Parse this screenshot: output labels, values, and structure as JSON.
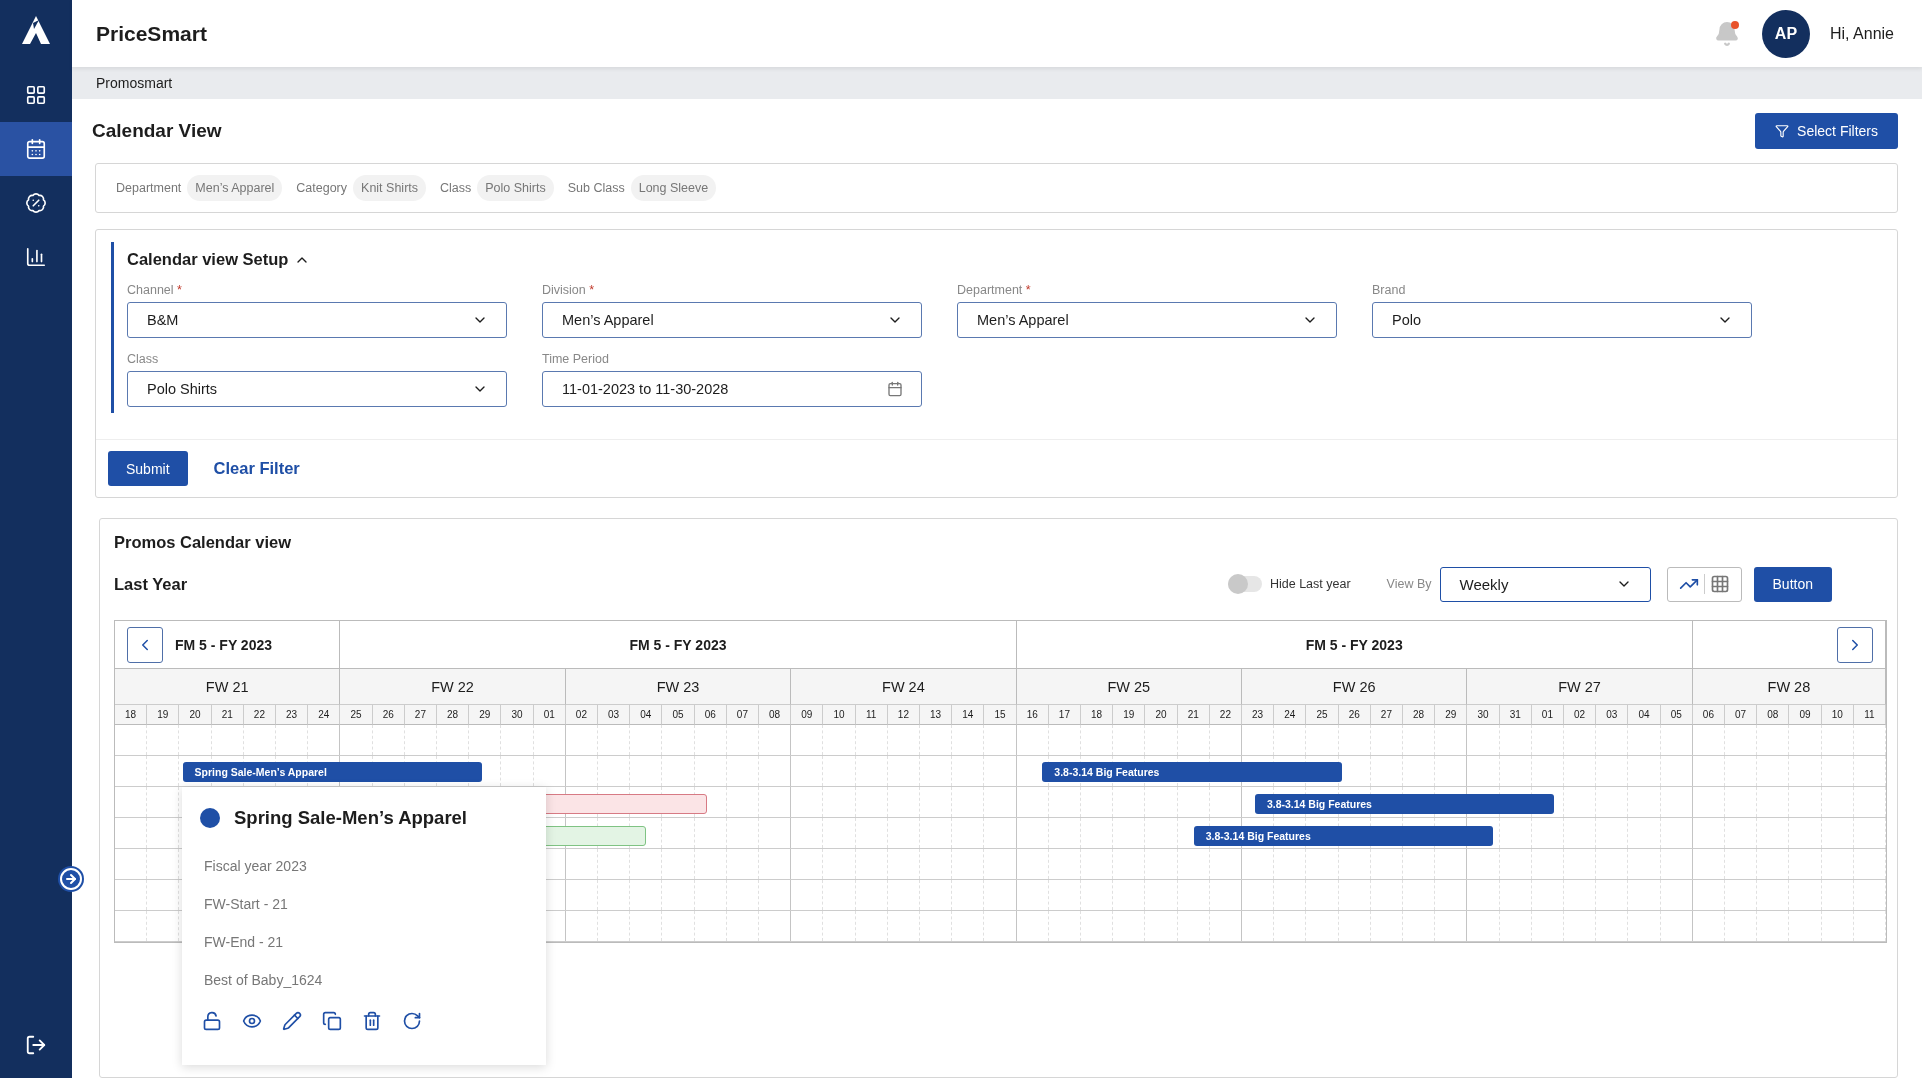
{
  "app": {
    "name": "PriceSmart"
  },
  "sidebar": {
    "items": [
      {
        "selected": false
      },
      {
        "selected": true
      },
      {
        "selected": false
      },
      {
        "selected": false
      }
    ]
  },
  "user": {
    "initials": "AP",
    "greeting": "Hi, Annie",
    "notification": true
  },
  "breadcrumb": "Promosmart",
  "page_title": "Calendar View",
  "select_filters_button": "Select Filters",
  "filter_summary": [
    {
      "label": "Department",
      "value": "Men’s Apparel"
    },
    {
      "label": "Category",
      "value": "Knit Shirts"
    },
    {
      "label": "Class",
      "value": "Polo Shirts"
    },
    {
      "label": "Sub Class",
      "value": "Long Sleeve"
    }
  ],
  "setup": {
    "title": "Calendar view Setup",
    "expanded": true,
    "required_mark": "*",
    "fields": [
      {
        "label": "Channel",
        "required": true,
        "value": "B&M",
        "kind": "select"
      },
      {
        "label": "Division",
        "required": true,
        "value": "Men’s Apparel",
        "kind": "select"
      },
      {
        "label": "Department",
        "required": true,
        "value": "Men’s Apparel",
        "kind": "select"
      },
      {
        "label": "Brand",
        "required": false,
        "value": "Polo",
        "kind": "select"
      },
      {
        "label": "Class",
        "required": false,
        "value": "Polo Shirts",
        "kind": "select"
      },
      {
        "label": "Time Period",
        "required": false,
        "value": "11-01-2023 to 11-30-2028",
        "kind": "date"
      }
    ],
    "submit": "Submit",
    "clear": "Clear Filter"
  },
  "promos": {
    "title": "Promos Calendar view",
    "subtitle": "Last Year",
    "hide_last_year": {
      "label": "Hide Last year",
      "on": false
    },
    "view_by": {
      "label": "View By",
      "value": "Weekly"
    },
    "view_modes": [
      {
        "kind": "chart",
        "selected": true
      },
      {
        "kind": "table",
        "selected": false
      }
    ],
    "button": "Button",
    "calendar": {
      "months": [
        "FM 5 - FY 2023",
        "FM 5 - FY 2023",
        "FM 5 - FY 2023"
      ],
      "weeks": [
        "FW 21",
        "FW 22",
        "FW 23",
        "FW 24",
        "FW 25",
        "FW 26",
        "FW 27",
        "FW 28"
      ],
      "days": [
        "18",
        "19",
        "20",
        "21",
        "22",
        "23",
        "24",
        "25",
        "26",
        "27",
        "28",
        "29",
        "30",
        "01",
        "02",
        "03",
        "04",
        "05",
        "06",
        "07",
        "08",
        "09",
        "10",
        "11",
        "12",
        "13",
        "14",
        "15",
        "16",
        "17",
        "18",
        "19",
        "20",
        "21",
        "22",
        "23",
        "24",
        "25",
        "26",
        "27",
        "28",
        "29",
        "30",
        "31",
        "01",
        "02",
        "03",
        "04",
        "05",
        "06",
        "07",
        "08",
        "09",
        "10",
        "11"
      ],
      "bars": [
        {
          "label": "Spring Sale-Men’s Apparel",
          "kind": "primary"
        },
        {
          "kind": "pink"
        },
        {
          "kind": "green"
        },
        {
          "label": "3.8-3.14 Big Features",
          "kind": "primary"
        },
        {
          "label": "3.8-3.14 Big Features",
          "kind": "primary"
        },
        {
          "label": "3.8-3.14 Big Features",
          "kind": "primary"
        }
      ]
    },
    "popover": {
      "title": "Spring Sale-Men’s Apparel",
      "details": [
        "Fiscal year 2023",
        "FW-Start - 21",
        "FW-End - 21",
        "Best of Baby_1624"
      ]
    }
  }
}
